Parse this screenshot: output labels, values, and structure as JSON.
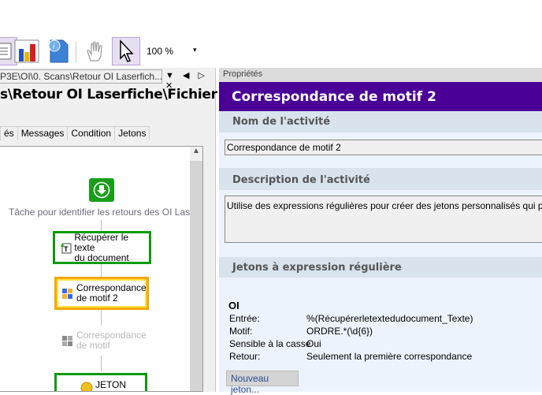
{
  "toolbar": {
    "zoom": "100 %",
    "zoom_dropdown": "▾"
  },
  "doc_tab": {
    "label": "P3E\\OI\\0. Scans\\Retour OI Laserfich...",
    "controls": "▼ ◀ ▷ ✕"
  },
  "doc_title": "s\\Retour OI Laserfiche\\Fichier ...",
  "tabs": [
    "és",
    "Messages",
    "Condition",
    "Jetons"
  ],
  "workflow": {
    "start_label": "Tâche pour identifier les retours des OI Laserfiche",
    "nodes": [
      {
        "line1": "Récupérer le texte",
        "line2": "du document"
      },
      {
        "line1": "Correspondance",
        "line2": "de motif 2"
      },
      {
        "line1": "Correspondance",
        "line2": "de motif"
      },
      {
        "line1": "JETON",
        "line2": ""
      }
    ]
  },
  "properties": {
    "header": "Propriétés",
    "title": "Correspondance de motif 2",
    "name_section": "Nom de l'activité",
    "name_value": "Correspondance de motif 2",
    "desc_section": "Description de l'activité",
    "desc_value": "Utilise des expressions régulières pour créer des jetons personnalisés qui peuvent être",
    "tokens_section": "Jetons à expression régulière",
    "token": {
      "name": "OI",
      "rows": [
        {
          "label": "Entrée:",
          "value": "%(Récupérerletextedudocument_Texte)"
        },
        {
          "label": "Motif:",
          "value": "ORDRE.*(\\d{6})"
        },
        {
          "label": "Sensible à la casse",
          "value": "Oui"
        },
        {
          "label": "Retour:",
          "value": "Seulement la première correspondance"
        }
      ]
    },
    "new_token_button": "Nouveau jeton..."
  }
}
